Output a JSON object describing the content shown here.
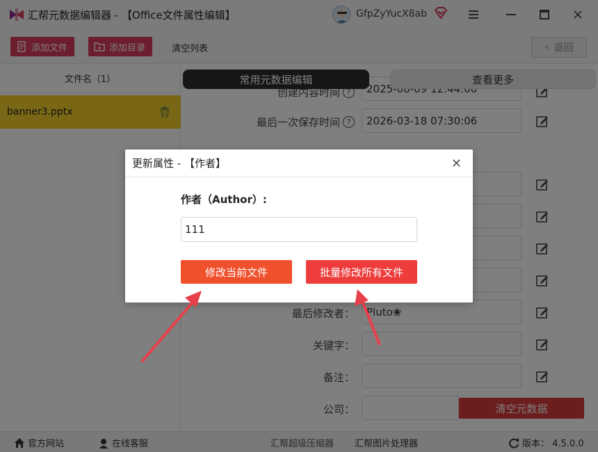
{
  "window": {
    "title": "汇帮元数据编辑器 - 【Office文件属性编辑】",
    "username": "GfpZyYucX8ab"
  },
  "toolbar": {
    "add_file": "添加文件",
    "add_dir": "添加目录",
    "clear_list": "清空列表",
    "back": "返回"
  },
  "sidebar": {
    "header": "文件名（1）",
    "files": [
      {
        "name": "banner3.pptx"
      }
    ]
  },
  "tabs": {
    "common": "常用元数据编辑",
    "more": "查看更多"
  },
  "fields": [
    {
      "label": "创建内容时间",
      "value": "2025-08-09 12:44:00",
      "help": true
    },
    {
      "label": "最后一次保存时间",
      "value": "2026-03-18 07:30:06",
      "help": true
    },
    {
      "label": "最后修改者：",
      "value": "Pluto❀"
    },
    {
      "label": "关键字：",
      "value": ""
    },
    {
      "label": "备注：",
      "value": ""
    },
    {
      "label": "公司：",
      "value": ""
    }
  ],
  "clear_metadata": "清空元数据",
  "statusbar": {
    "website": "官方网站",
    "service": "在线客服",
    "compressor": "汇帮超级压缩器",
    "image_tool": "汇帮图片处理器",
    "version": "版本： 4.5.0.0"
  },
  "dialog": {
    "title": "更新属性 - 【作者】",
    "field_label": "作者（Author）:",
    "field_value": "111",
    "btn_current": "修改当前文件",
    "btn_all": "批量修改所有文件"
  },
  "colors": {
    "accent_pink": "#d93a5c",
    "accent_orange": "#f0502c",
    "selected_file": "#f2cf2d",
    "arrow": "#e8404a"
  }
}
